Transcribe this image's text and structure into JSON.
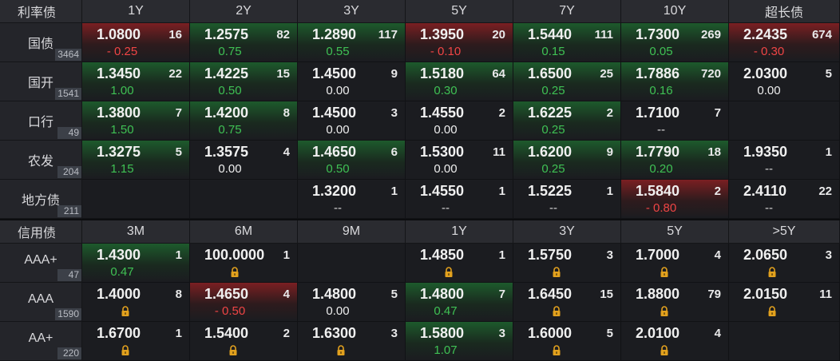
{
  "rate_section": {
    "corner": "利率债",
    "tenors": [
      "1Y",
      "2Y",
      "3Y",
      "5Y",
      "7Y",
      "10Y",
      "超长债"
    ],
    "rows": [
      {
        "name": "国债",
        "count": "3464",
        "cells": [
          {
            "y": "1.0800",
            "v": "16",
            "c": "- 0.25",
            "t": "neg",
            "bg": "red"
          },
          {
            "y": "1.2575",
            "v": "82",
            "c": "0.75",
            "t": "pos",
            "bg": "green"
          },
          {
            "y": "1.2890",
            "v": "117",
            "c": "0.55",
            "t": "pos",
            "bg": "green"
          },
          {
            "y": "1.3950",
            "v": "20",
            "c": "- 0.10",
            "t": "neg",
            "bg": "red"
          },
          {
            "y": "1.5440",
            "v": "111",
            "c": "0.15",
            "t": "pos",
            "bg": "green"
          },
          {
            "y": "1.7300",
            "v": "269",
            "c": "0.05",
            "t": "pos",
            "bg": "green"
          },
          {
            "y": "2.2435",
            "v": "674",
            "c": "- 0.30",
            "t": "neg",
            "bg": "red"
          }
        ]
      },
      {
        "name": "国开",
        "count": "1541",
        "cells": [
          {
            "y": "1.3450",
            "v": "22",
            "c": "1.00",
            "t": "pos",
            "bg": "green"
          },
          {
            "y": "1.4225",
            "v": "15",
            "c": "0.50",
            "t": "pos",
            "bg": "green"
          },
          {
            "y": "1.4500",
            "v": "9",
            "c": "0.00",
            "t": "zero",
            "bg": "none"
          },
          {
            "y": "1.5180",
            "v": "64",
            "c": "0.30",
            "t": "pos",
            "bg": "green"
          },
          {
            "y": "1.6500",
            "v": "25",
            "c": "0.25",
            "t": "pos",
            "bg": "green"
          },
          {
            "y": "1.7886",
            "v": "720",
            "c": "0.16",
            "t": "pos",
            "bg": "green"
          },
          {
            "y": "2.0300",
            "v": "5",
            "c": "0.00",
            "t": "zero",
            "bg": "none"
          }
        ]
      },
      {
        "name": "口行",
        "count": "49",
        "cells": [
          {
            "y": "1.3800",
            "v": "7",
            "c": "1.50",
            "t": "pos",
            "bg": "green"
          },
          {
            "y": "1.4200",
            "v": "8",
            "c": "0.75",
            "t": "pos",
            "bg": "green"
          },
          {
            "y": "1.4500",
            "v": "3",
            "c": "0.00",
            "t": "zero",
            "bg": "none"
          },
          {
            "y": "1.4550",
            "v": "2",
            "c": "0.00",
            "t": "zero",
            "bg": "none"
          },
          {
            "y": "1.6225",
            "v": "2",
            "c": "0.25",
            "t": "pos",
            "bg": "green"
          },
          {
            "y": "1.7100",
            "v": "7",
            "c": "--",
            "t": "dash",
            "bg": "none"
          },
          {
            "y": "",
            "v": "",
            "c": "",
            "t": "zero",
            "bg": "none"
          }
        ]
      },
      {
        "name": "农发",
        "count": "204",
        "cells": [
          {
            "y": "1.3275",
            "v": "5",
            "c": "1.15",
            "t": "pos",
            "bg": "green"
          },
          {
            "y": "1.3575",
            "v": "4",
            "c": "0.00",
            "t": "zero",
            "bg": "none"
          },
          {
            "y": "1.4650",
            "v": "6",
            "c": "0.50",
            "t": "pos",
            "bg": "green"
          },
          {
            "y": "1.5300",
            "v": "11",
            "c": "0.00",
            "t": "zero",
            "bg": "none"
          },
          {
            "y": "1.6200",
            "v": "9",
            "c": "0.25",
            "t": "pos",
            "bg": "green"
          },
          {
            "y": "1.7790",
            "v": "18",
            "c": "0.20",
            "t": "pos",
            "bg": "green"
          },
          {
            "y": "1.9350",
            "v": "1",
            "c": "--",
            "t": "dash",
            "bg": "none"
          }
        ]
      },
      {
        "name": "地方债",
        "count": "211",
        "cells": [
          {
            "y": "",
            "v": "",
            "c": "",
            "t": "zero",
            "bg": "none"
          },
          {
            "y": "",
            "v": "",
            "c": "",
            "t": "zero",
            "bg": "none"
          },
          {
            "y": "1.3200",
            "v": "1",
            "c": "--",
            "t": "dash",
            "bg": "none"
          },
          {
            "y": "1.4550",
            "v": "1",
            "c": "--",
            "t": "dash",
            "bg": "none"
          },
          {
            "y": "1.5225",
            "v": "1",
            "c": "--",
            "t": "dash",
            "bg": "none"
          },
          {
            "y": "1.5840",
            "v": "2",
            "c": "- 0.80",
            "t": "neg",
            "bg": "red"
          },
          {
            "y": "2.4110",
            "v": "22",
            "c": "--",
            "t": "dash",
            "bg": "none"
          }
        ]
      }
    ]
  },
  "credit_section": {
    "corner": "信用债",
    "tenors": [
      "3M",
      "6M",
      "9M",
      "1Y",
      "3Y",
      "5Y",
      ">5Y"
    ],
    "rows": [
      {
        "name": "AAA+",
        "count": "47",
        "cells": [
          {
            "y": "1.4300",
            "v": "1",
            "c": "0.47",
            "t": "pos",
            "bg": "green"
          },
          {
            "y": "100.0000",
            "v": "1",
            "c": "lock",
            "t": "lock",
            "bg": "none"
          },
          {
            "y": "",
            "v": "",
            "c": "",
            "t": "zero",
            "bg": "none"
          },
          {
            "y": "1.4850",
            "v": "1",
            "c": "lock",
            "t": "lock",
            "bg": "none"
          },
          {
            "y": "1.5750",
            "v": "3",
            "c": "lock",
            "t": "lock",
            "bg": "none"
          },
          {
            "y": "1.7000",
            "v": "4",
            "c": "lock",
            "t": "lock",
            "bg": "none"
          },
          {
            "y": "2.0650",
            "v": "3",
            "c": "lock",
            "t": "lock",
            "bg": "none"
          }
        ]
      },
      {
        "name": "AAA",
        "count": "1590",
        "cells": [
          {
            "y": "1.4000",
            "v": "8",
            "c": "lock",
            "t": "lock",
            "bg": "none"
          },
          {
            "y": "1.4650",
            "v": "4",
            "c": "- 0.50",
            "t": "neg",
            "bg": "red"
          },
          {
            "y": "1.4800",
            "v": "5",
            "c": "0.00",
            "t": "zero",
            "bg": "none"
          },
          {
            "y": "1.4800",
            "v": "7",
            "c": "0.47",
            "t": "pos",
            "bg": "green"
          },
          {
            "y": "1.6450",
            "v": "15",
            "c": "lock",
            "t": "lock",
            "bg": "none"
          },
          {
            "y": "1.8800",
            "v": "79",
            "c": "lock",
            "t": "lock",
            "bg": "none"
          },
          {
            "y": "2.0150",
            "v": "11",
            "c": "lock",
            "t": "lock",
            "bg": "none"
          }
        ]
      },
      {
        "name": "AA+",
        "count": "220",
        "cells": [
          {
            "y": "1.6700",
            "v": "1",
            "c": "lock",
            "t": "lock",
            "bg": "none"
          },
          {
            "y": "1.5400",
            "v": "2",
            "c": "lock",
            "t": "lock",
            "bg": "none"
          },
          {
            "y": "1.6300",
            "v": "3",
            "c": "lock",
            "t": "lock",
            "bg": "none"
          },
          {
            "y": "1.5800",
            "v": "3",
            "c": "1.07",
            "t": "pos",
            "bg": "green"
          },
          {
            "y": "1.6000",
            "v": "5",
            "c": "lock",
            "t": "lock",
            "bg": "none"
          },
          {
            "y": "2.0100",
            "v": "4",
            "c": "lock",
            "t": "lock",
            "bg": "none"
          },
          {
            "y": "",
            "v": "",
            "c": "",
            "t": "zero",
            "bg": "none"
          }
        ]
      }
    ]
  }
}
